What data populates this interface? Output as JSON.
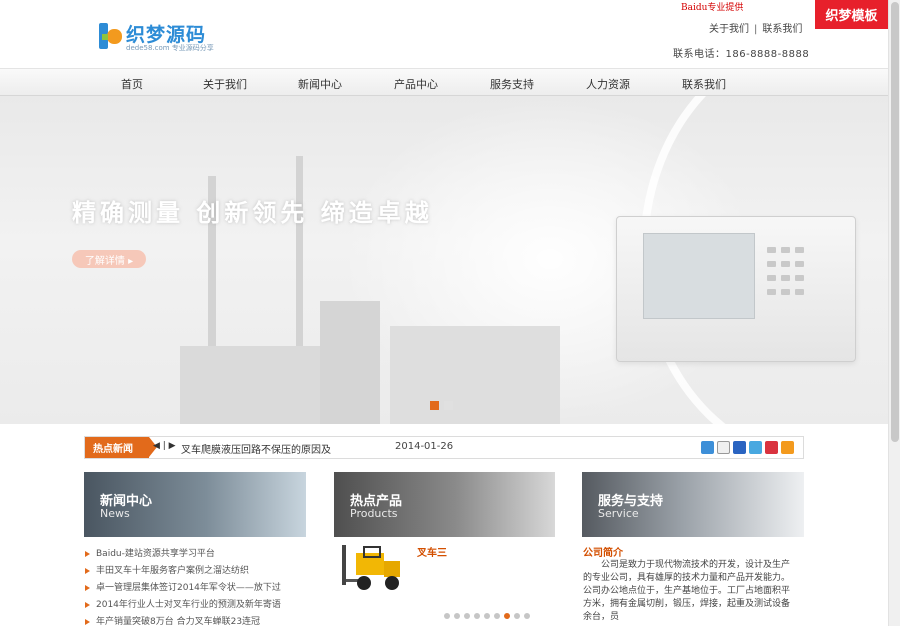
{
  "header": {
    "logo_text": "织梦源码",
    "logo_sub": "dede58.com 专业源码分享",
    "baidu_tag": "Baidu专业提供",
    "top_links": [
      "关于我们",
      "联系我们"
    ],
    "phone": "联系电话：186-8888-8888",
    "badge": "织梦模板"
  },
  "nav": {
    "items": [
      "首页",
      "关于我们",
      "新闻中心",
      "产品中心",
      "服务支持",
      "人力资源",
      "联系我们"
    ]
  },
  "banner": {
    "slogan": "精确测量  创新领先  缔造卓越",
    "button": "了解详情 ▸",
    "slide_count": 2,
    "active_slide": 0,
    "colors": {
      "active_dot": "#e26a1b",
      "dot": "#e0e0e0"
    }
  },
  "hot_news": {
    "label": "热点新闻",
    "controls": "◀ | ▶",
    "title": "叉车爬膜液压回路不保压的原因及",
    "date": "2014-01-26",
    "share_icons": [
      "qzone-icon",
      "camera-icon",
      "renren-icon",
      "weibo-icon",
      "kaixin-icon",
      "plus-icon"
    ]
  },
  "news": {
    "title": "新闻中心",
    "subtitle": "News",
    "items": [
      "Baidu-建站资源共享学习平台",
      "丰田叉车十年服务客户案例之溜达纺织",
      "卓一管理层集体签订2014年军令状——放下过",
      "2014年行业人士对叉车行业的预测及新年寄语",
      "年产销量突破8万台 合力叉车蝉联23连冠"
    ]
  },
  "products": {
    "title": "热点产品",
    "subtitle": "Products",
    "item_title": "叉车三",
    "page_count": 9,
    "active_page": 6
  },
  "service": {
    "title": "服务与支持",
    "subtitle": "Service",
    "about_title": "公司简介",
    "about_text": "公司是致力于现代物流技术的开发，设计及生产的专业公司，具有雄厚的技术力量和产品开发能力。公司办公地点位于，生产基地位于。工厂占地面积平方米，拥有金属切削，锻压，焊接，起重及测试设备余台，员"
  },
  "colors": {
    "accent": "#e26a1b",
    "red_badge": "#e7202b",
    "logo_blue": "#2d8cd6"
  }
}
